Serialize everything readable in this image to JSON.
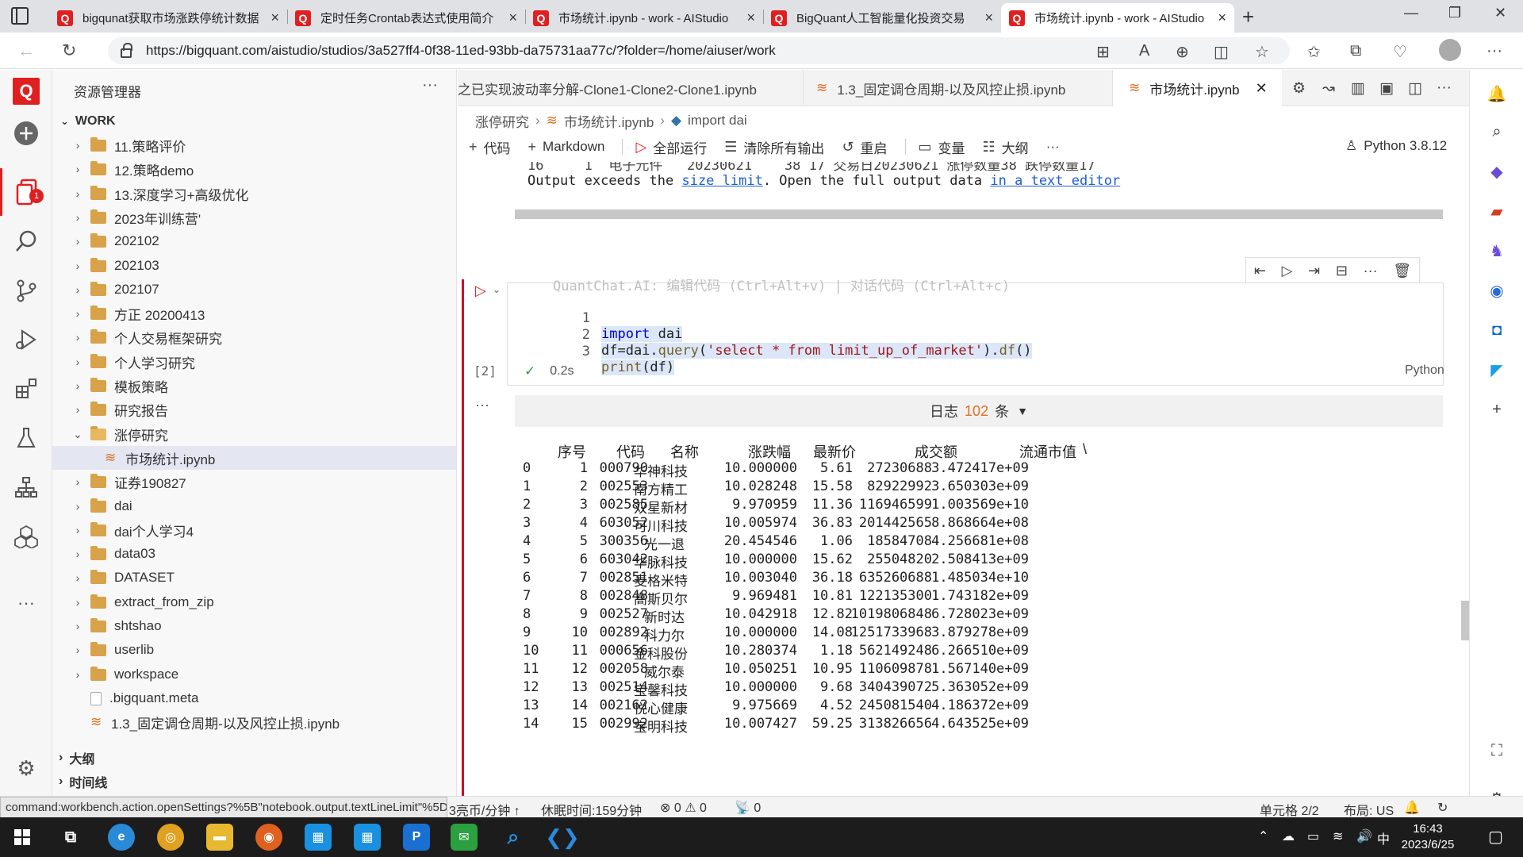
{
  "browser": {
    "tabs": [
      {
        "title": "bigqunat获取市场涨跌停统计数据",
        "active": false
      },
      {
        "title": "定时任务Crontab表达式使用简介",
        "active": false
      },
      {
        "title": "市场统计.ipynb - work - AIStudio",
        "active": false
      },
      {
        "title": "BigQuant人工智能量化投资交易",
        "active": false
      },
      {
        "title": "市场统计.ipynb - work - AIStudio",
        "active": true
      }
    ],
    "url": "https://bigquant.com/aistudio/studios/3a527ff4-0f38-11ed-93bb-da75731aa77c/?folder=/home/aiuser/work"
  },
  "activity_bar": {
    "logo": "Q",
    "explorer_badge": "1"
  },
  "sidebar": {
    "title": "资源管理器",
    "more": "···",
    "root": "WORK",
    "items": [
      {
        "label": "11.策略评价",
        "type": "folder",
        "level": 0
      },
      {
        "label": "12.策略demo",
        "type": "folder",
        "level": 0
      },
      {
        "label": "13.深度学习+高级优化",
        "type": "folder",
        "level": 0
      },
      {
        "label": "2023年训练营'",
        "type": "folder",
        "level": 0
      },
      {
        "label": "202102",
        "type": "folder",
        "level": 0
      },
      {
        "label": "202103",
        "type": "folder",
        "level": 0
      },
      {
        "label": "202107",
        "type": "folder",
        "level": 0
      },
      {
        "label": "方正 20200413",
        "type": "folder",
        "level": 0
      },
      {
        "label": "个人交易框架研究",
        "type": "folder",
        "level": 0
      },
      {
        "label": "个人学习研究",
        "type": "folder",
        "level": 0
      },
      {
        "label": "模板策略",
        "type": "folder",
        "level": 0
      },
      {
        "label": "研究报告",
        "type": "folder",
        "level": 0
      },
      {
        "label": "涨停研究",
        "type": "folder-open",
        "level": 0
      },
      {
        "label": "市场统计.ipynb",
        "type": "notebook",
        "level": 1,
        "selected": true
      },
      {
        "label": "证券190827",
        "type": "folder",
        "level": 0
      },
      {
        "label": "dai",
        "type": "folder",
        "level": 0
      },
      {
        "label": "dai个人学习4",
        "type": "folder",
        "level": 0
      },
      {
        "label": "data03",
        "type": "folder",
        "level": 0
      },
      {
        "label": "DATASET",
        "type": "folder",
        "level": 0
      },
      {
        "label": "extract_from_zip",
        "type": "folder",
        "level": 0
      },
      {
        "label": "shtshao",
        "type": "folder",
        "level": 0
      },
      {
        "label": "userlib",
        "type": "folder",
        "level": 0
      },
      {
        "label": "workspace",
        "type": "folder",
        "level": 0
      },
      {
        "label": ".bigquant.meta",
        "type": "file",
        "level": 0
      },
      {
        "label": "1.3_固定调仓周期-以及风控止损.ipynb",
        "type": "notebook",
        "level": 0
      }
    ],
    "sections": [
      "大纲",
      "时间线"
    ]
  },
  "editor": {
    "tabs": [
      {
        "title": "之已实现波动率分解-Clone1-Clone2-Clone1.ipynb",
        "active": false
      },
      {
        "title": "1.3_固定调仓周期-以及风控止损.ipynb",
        "active": false
      },
      {
        "title": "市场统计.ipynb",
        "active": true
      }
    ],
    "breadcrumb": [
      "涨停研究",
      "市场统计.ipynb",
      "import dai"
    ],
    "toolbar": [
      {
        "label": "代码",
        "icon": "plus-icon"
      },
      {
        "label": "Markdown",
        "icon": "plus-icon"
      },
      {
        "label": "全部运行",
        "icon": "run-all-icon"
      },
      {
        "label": "清除所有输出",
        "icon": "clear-icon"
      },
      {
        "label": "重启",
        "icon": "restart-icon"
      },
      {
        "label": "变量",
        "icon": "variables-icon"
      },
      {
        "label": "大纲",
        "icon": "outline-icon"
      },
      {
        "label": "···",
        "icon": "more-icon"
      }
    ],
    "kernel": "Python 3.8.12"
  },
  "prev_output": {
    "line1": "16     1  电子元件   20230621    38 17 交易日20230621 涨停数量38 跌停数量17",
    "exceeds_prefix": "Output exceeds the ",
    "size_link": "size limit",
    "exceeds_middle": ". Open the full output data ",
    "editor_link": "in a text editor"
  },
  "cell": {
    "lines": [
      {
        "num": "1",
        "code": "import dai"
      },
      {
        "num": "2",
        "code": "df=dai.query('select * from limit_up_of_market').df()"
      },
      {
        "num": "3",
        "code": "print(df)"
      }
    ],
    "ghost_hint": "QuantChat.AI: 编辑代码 (Ctrl+Alt+v) | 对话代码 (Ctrl+Alt+c)",
    "exec_count": "[2]",
    "duration": "0.2s",
    "language": "Python"
  },
  "output": {
    "log_label": "日志",
    "log_count": "102",
    "log_unit": "条",
    "columns": [
      "序号",
      "代码",
      "名称",
      "涨跌幅",
      "最新价",
      "成交额",
      "流通市值",
      "\\"
    ],
    "rows": [
      [
        "0",
        "1",
        "000790",
        "华神科技",
        "10.000000",
        "5.61",
        "27230688",
        "3.472417e+09"
      ],
      [
        "1",
        "2",
        "002553",
        "南方精工",
        "10.028248",
        "15.58",
        "82922992",
        "3.650303e+09"
      ],
      [
        "2",
        "3",
        "002585",
        "双星新材",
        "9.970959",
        "11.36",
        "116946599",
        "1.003569e+10"
      ],
      [
        "3",
        "4",
        "603052",
        "可川科技",
        "10.005974",
        "36.83",
        "201442565",
        "8.868664e+08"
      ],
      [
        "4",
        "5",
        "300356",
        "光一退",
        "20.454546",
        "1.06",
        "18584708",
        "4.256681e+08"
      ],
      [
        "5",
        "6",
        "603042",
        "华脉科技",
        "10.000000",
        "15.62",
        "25504820",
        "2.508413e+09"
      ],
      [
        "6",
        "7",
        "002851",
        "麦格米特",
        "10.003040",
        "36.18",
        "635260688",
        "1.485034e+10"
      ],
      [
        "7",
        "8",
        "002848",
        "高斯贝尔",
        "9.969481",
        "10.81",
        "122135300",
        "1.743182e+09"
      ],
      [
        "8",
        "9",
        "002527",
        "新时达",
        "10.042918",
        "12.82",
        "1019806848",
        "6.728023e+09"
      ],
      [
        "9",
        "10",
        "002892",
        "科力尔",
        "10.000000",
        "14.08",
        "1251733968",
        "3.879278e+09"
      ],
      [
        "10",
        "11",
        "000656",
        "金科股份",
        "10.280374",
        "1.18",
        "562149248",
        "6.266510e+09"
      ],
      [
        "11",
        "12",
        "002058",
        "威尔泰",
        "10.050251",
        "10.95",
        "110609878",
        "1.567140e+09"
      ],
      [
        "12",
        "13",
        "002514",
        "宝馨科技",
        "10.000000",
        "9.68",
        "340439072",
        "5.363052e+09"
      ],
      [
        "13",
        "14",
        "002162",
        "悦心健康",
        "9.975669",
        "4.52",
        "245081540",
        "4.186372e+09"
      ],
      [
        "14",
        "15",
        "002992",
        "宝明科技",
        "10.007427",
        "59.25",
        "313826656",
        "4.643525e+09"
      ]
    ]
  },
  "statusbar": {
    "command": "command:workbench.action.openSettings?%5B\"notebook.output.textLineLimit\"%5D",
    "rate": "3亮币/分钟 ↑",
    "sleep": "休眠时间:159分钟",
    "problems": "⊗ 0 ⚠ 0",
    "ports": "0",
    "cell": "单元格 2/2",
    "layout": "布局: US"
  },
  "taskbar": {
    "time": "16:43",
    "date": "2023/6/25",
    "ime": "中"
  },
  "colors": {
    "accent": "#e02020",
    "link": "#1f5fcf",
    "count": "#e07020"
  }
}
